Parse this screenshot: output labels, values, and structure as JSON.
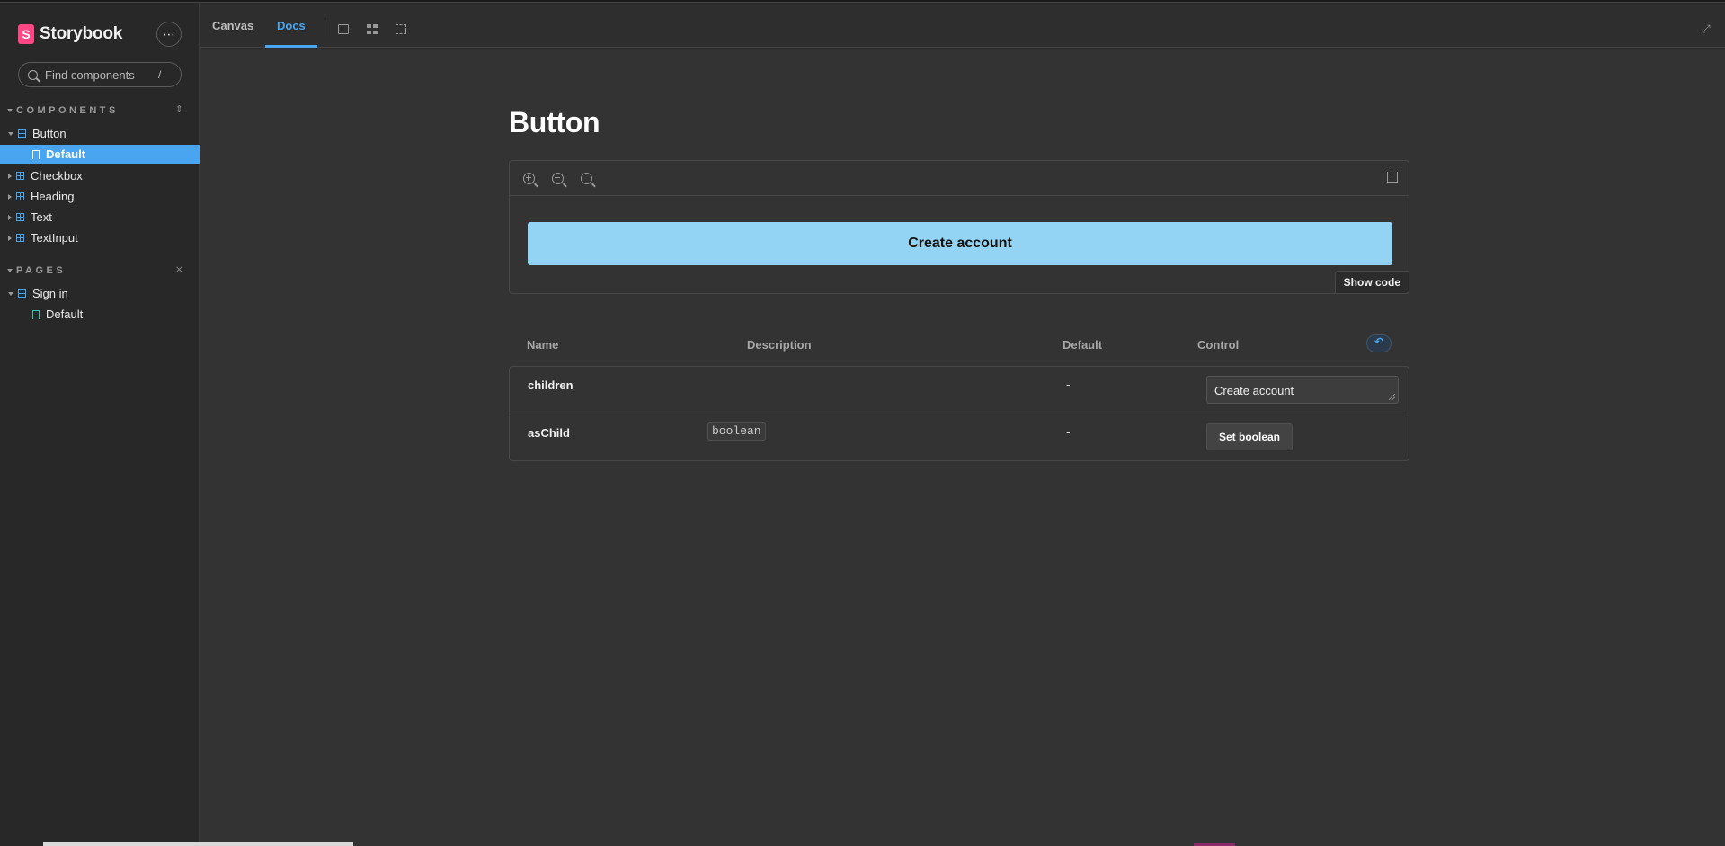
{
  "sidebar": {
    "brand": "Storybook",
    "search_placeholder": "Find components",
    "search_shortcut": "/",
    "more_label": "⋯",
    "components_title": "COMPONENTS",
    "pages_title": "PAGES",
    "components": [
      {
        "label": "Button",
        "expanded": true
      },
      {
        "label": "Default",
        "story": true,
        "selected": true
      },
      {
        "label": "Checkbox"
      },
      {
        "label": "Heading"
      },
      {
        "label": "Text"
      },
      {
        "label": "TextInput"
      }
    ],
    "pages": [
      {
        "label": "Sign in",
        "expanded": true
      },
      {
        "label": "Default",
        "story": true
      }
    ]
  },
  "toolbar": {
    "tabs": [
      "Canvas",
      "Docs"
    ],
    "active_tab": "Docs",
    "icons": [
      "image-icon",
      "grid-icon",
      "outline-icon",
      "fullscreen-icon"
    ]
  },
  "docs": {
    "title": "Button",
    "preview_button": "Create account",
    "show_code": "Show code",
    "args_headers": [
      "Name",
      "Description",
      "Default",
      "Control"
    ],
    "args": [
      {
        "name": "children",
        "description": "",
        "default": "-",
        "control_value": "Create account"
      },
      {
        "name": "asChild",
        "description": "boolean",
        "default": "-",
        "control_label": "Set boolean"
      }
    ]
  },
  "colors": {
    "accent": "#4aa5f0",
    "preview_button_bg": "#93d4f5",
    "brand_pink": "#ff4785"
  }
}
